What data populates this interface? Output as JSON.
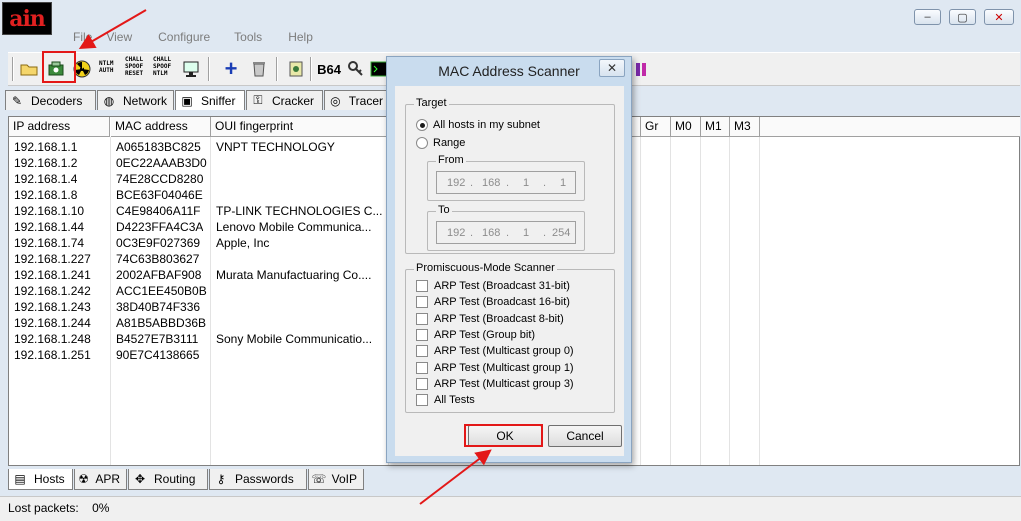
{
  "app": {
    "logo_text": "ain"
  },
  "window_controls": {
    "minimize": "‒",
    "restore": "▢",
    "close": "✕"
  },
  "menu": [
    "File",
    "View",
    "Configure",
    "Tools",
    "Help"
  ],
  "toolbar": {
    "ntlm_auth": "NTLM\nAUTH",
    "chall_spoof_reset": "CHALL\nSPOOF\nRESET",
    "chall_spoof_ntlm": "CHALL\nSPOOF\nNTLM",
    "b64": "B64"
  },
  "top_tabs": [
    {
      "label": "Decoders",
      "icon": "decoder-icon"
    },
    {
      "label": "Network",
      "icon": "network-icon"
    },
    {
      "label": "Sniffer",
      "icon": "sniffer-icon"
    },
    {
      "label": "Cracker",
      "icon": "cracker-icon"
    },
    {
      "label": "Tracer",
      "icon": "tracer-icon"
    }
  ],
  "columns": [
    "IP address",
    "MAC address",
    "OUI fingerprint",
    "Gr",
    "M0",
    "M1",
    "M3"
  ],
  "hosts": [
    {
      "ip": "192.168.1.1",
      "mac": "A065183BC825",
      "oui": "VNPT TECHNOLOGY"
    },
    {
      "ip": "192.168.1.2",
      "mac": "0EC22AAAB3D0",
      "oui": ""
    },
    {
      "ip": "192.168.1.4",
      "mac": "74E28CCD8280",
      "oui": ""
    },
    {
      "ip": "192.168.1.8",
      "mac": "BCE63F04046E",
      "oui": ""
    },
    {
      "ip": "192.168.1.10",
      "mac": "C4E98406A11F",
      "oui": "TP-LINK TECHNOLOGIES C..."
    },
    {
      "ip": "192.168.1.44",
      "mac": "D4223FFA4C3A",
      "oui": "Lenovo Mobile Communica..."
    },
    {
      "ip": "192.168.1.74",
      "mac": "0C3E9F027369",
      "oui": "Apple, Inc"
    },
    {
      "ip": "192.168.1.227",
      "mac": "74C63B803627",
      "oui": ""
    },
    {
      "ip": "192.168.1.241",
      "mac": "2002AFBAF908",
      "oui": "Murata Manufactuaring Co...."
    },
    {
      "ip": "192.168.1.242",
      "mac": "ACC1EE450B0B",
      "oui": ""
    },
    {
      "ip": "192.168.1.243",
      "mac": "38D40B74F336",
      "oui": ""
    },
    {
      "ip": "192.168.1.244",
      "mac": "A81B5ABBD36B",
      "oui": ""
    },
    {
      "ip": "192.168.1.248",
      "mac": "B4527E7B3111",
      "oui": "Sony Mobile Communicatio..."
    },
    {
      "ip": "192.168.1.251",
      "mac": "90E7C4138665",
      "oui": ""
    }
  ],
  "bottom_tabs": [
    {
      "label": "Hosts",
      "icon": "hosts-icon"
    },
    {
      "label": "APR",
      "icon": "apr-icon"
    },
    {
      "label": "Routing",
      "icon": "routing-icon"
    },
    {
      "label": "Passwords",
      "icon": "passwords-icon"
    },
    {
      "label": "VoIP",
      "icon": "voip-icon"
    }
  ],
  "status": {
    "lost_packets_label": "Lost packets:",
    "lost_packets_value": "0%"
  },
  "dialog": {
    "title": "MAC Address Scanner",
    "close": "✕",
    "target_legend": "Target",
    "all_hosts_label": "All hosts in my subnet",
    "range_label": "Range",
    "from_legend": "From",
    "from_ip": [
      "192",
      "168",
      "1",
      "1"
    ],
    "to_legend": "To",
    "to_ip": [
      "192",
      "168",
      "1",
      "254"
    ],
    "promisc_legend": "Promiscuous-Mode Scanner",
    "tests": [
      "ARP Test (Broadcast 31-bit)",
      "ARP Test (Broadcast 16-bit)",
      "ARP Test (Broadcast 8-bit)",
      "ARP Test (Group bit)",
      "ARP Test (Multicast group 0)",
      "ARP Test (Multicast group 1)",
      "ARP Test (Multicast group 3)",
      "All Tests"
    ],
    "ok_label": "OK",
    "cancel_label": "Cancel"
  },
  "accent_colors": {
    "highlight_red": "#e31818"
  }
}
